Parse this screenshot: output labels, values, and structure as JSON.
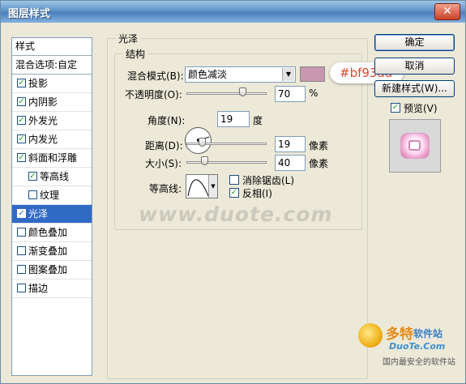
{
  "window": {
    "title": "图层样式",
    "close_label": "✕"
  },
  "style_list": {
    "header": "样式",
    "blend_options": "混合选项:自定",
    "items": [
      {
        "label": "投影",
        "checked": true
      },
      {
        "label": "内阴影",
        "checked": true
      },
      {
        "label": "外发光",
        "checked": true
      },
      {
        "label": "内发光",
        "checked": true
      },
      {
        "label": "斜面和浮雕",
        "checked": true
      },
      {
        "label": "等高线",
        "checked": true
      },
      {
        "label": "纹理",
        "checked": false
      },
      {
        "label": "光泽",
        "checked": true
      },
      {
        "label": "颜色叠加",
        "checked": false
      },
      {
        "label": "渐变叠加",
        "checked": false
      },
      {
        "label": "图案叠加",
        "checked": false
      },
      {
        "label": "描边",
        "checked": false
      }
    ],
    "check_mark": "✓"
  },
  "satin": {
    "title": "光泽",
    "structure_title": "结构",
    "blend_mode_label": "混合模式(B):",
    "blend_mode_value": "颜色减淡",
    "color_hex": "#bf93ad",
    "swatch_color": "#c797b0",
    "opacity_label": "不透明度(O):",
    "opacity_value": "70",
    "opacity_unit": "%",
    "opacity_level": 0.7,
    "angle_label": "角度(N):",
    "angle_value": "19",
    "angle_unit": "度",
    "distance_label": "距离(D):",
    "distance_value": "19",
    "distance_unit": "像素",
    "size_label": "大小(S):",
    "size_value": "40",
    "size_unit": "像素",
    "contour_label": "等高线:",
    "anti_alias_label": "消除锯齿(L)",
    "anti_alias_checked": false,
    "invert_label": "反相(I)",
    "invert_checked": true
  },
  "buttons": {
    "ok": "确定",
    "cancel": "取消",
    "new_style": "新建样式(W)...",
    "preview_label": "预览(V)",
    "preview_checked": true
  },
  "watermark": "www.duote.com",
  "logo": {
    "brand": "多特",
    "tagline": "软件站",
    "domain": "DuoTe.Com",
    "slogan": "国内最安全的软件站"
  }
}
